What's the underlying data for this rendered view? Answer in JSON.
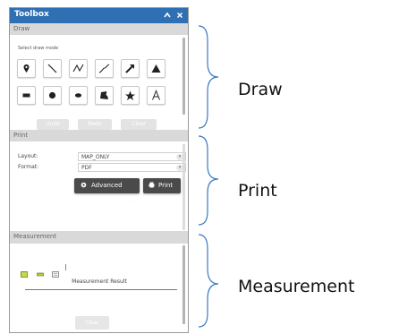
{
  "toolbox": {
    "title": "Toolbox",
    "accent": "#2f6fb3",
    "icons": [
      "collapse-chevron-icon",
      "close-icon"
    ]
  },
  "draw": {
    "header": "Draw",
    "mode_label": "Select draw mode",
    "tools": [
      "point-icon",
      "line-icon",
      "polyline-icon",
      "freehand-line-icon",
      "arrow-icon",
      "triangle-icon",
      "rectangle-icon",
      "circle-icon",
      "ellipse-icon",
      "freehand-polygon-icon",
      "star-icon",
      "text-icon"
    ],
    "buttons": [
      "Undo",
      "Redo",
      "Clear"
    ]
  },
  "print": {
    "header": "Print",
    "layout_label": "Layout:",
    "layout_value": "MAP_ONLY",
    "format_label": "Format:",
    "format_value": "PDF",
    "advanced_label": "Advanced",
    "print_label": "Print"
  },
  "measurement": {
    "header": "Measurement",
    "tools": [
      "area-icon",
      "distance-icon",
      "location-icon"
    ],
    "result_label": "Measurement Result",
    "clear_label": "Clear"
  },
  "callouts": {
    "draw": "Draw",
    "print": "Print",
    "measurement": "Measurement"
  }
}
